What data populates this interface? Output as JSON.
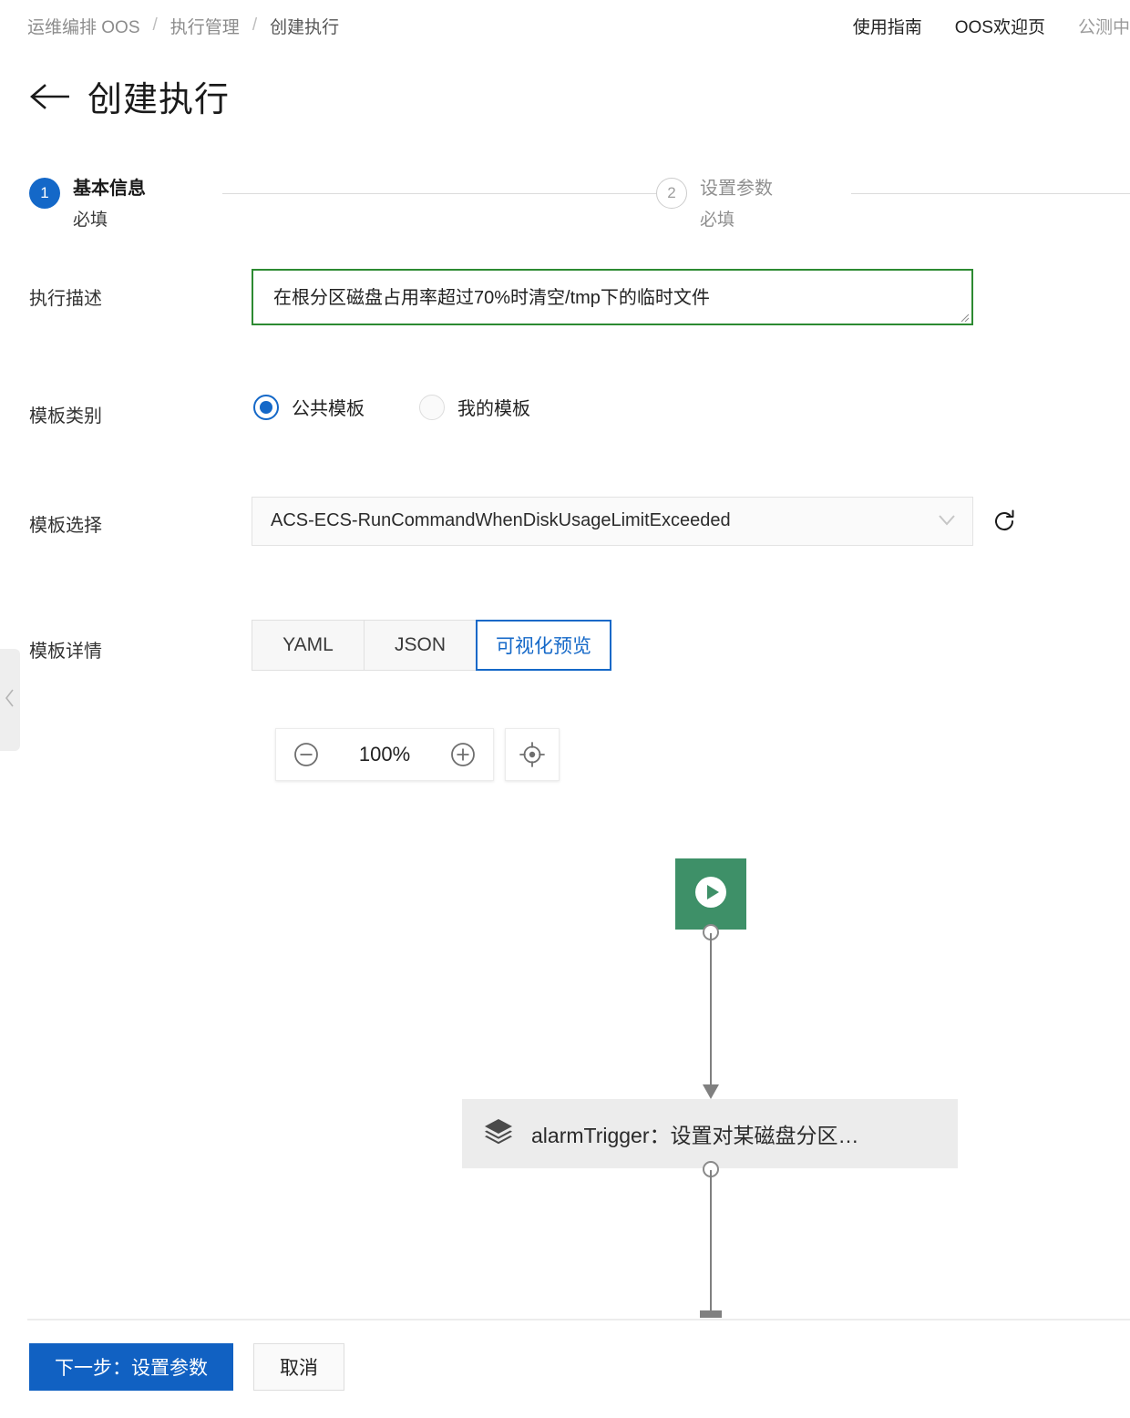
{
  "topbar": {
    "breadcrumb": [
      {
        "label": "运维编排 OOS",
        "current": false
      },
      {
        "label": "执行管理",
        "current": false
      },
      {
        "label": "创建执行",
        "current": true
      }
    ],
    "separator": "/",
    "links": [
      {
        "label": "使用指南"
      },
      {
        "label": "OOS欢迎页"
      },
      {
        "label": "公测中"
      }
    ]
  },
  "page": {
    "back_icon": "arrow-left-icon",
    "title": "创建执行"
  },
  "steps": [
    {
      "number": "1",
      "label": "基本信息",
      "sub": "必填",
      "state": "active"
    },
    {
      "number": "2",
      "label": "设置参数",
      "sub": "必填",
      "state": "inactive"
    }
  ],
  "form": {
    "description": {
      "label": "执行描述",
      "value": "在根分区磁盘占用率超过70%时清空/tmp下的临时文件",
      "placeholder": "请输入执行描述",
      "border_color": "#2d8a32"
    },
    "template_category": {
      "label": "模板类别",
      "options": [
        {
          "label": "公共模板",
          "selected": true
        },
        {
          "label": "我的模板",
          "selected": false
        }
      ]
    },
    "template_select": {
      "label": "模板选择",
      "value": "ACS-ECS-RunCommandWhenDiskUsageLimitExceeded",
      "placeholder": "请选择模板",
      "caret_icon": "chevron-down-icon",
      "refresh_icon": "refresh-icon"
    },
    "template_detail": {
      "label": "模板详情",
      "tabs": [
        {
          "label": "YAML",
          "active": false
        },
        {
          "label": "JSON",
          "active": false
        },
        {
          "label": "可视化预览",
          "active": true
        }
      ]
    }
  },
  "canvas": {
    "zoom": {
      "minus_icon": "minus-circle-icon",
      "value": "100%",
      "plus_icon": "plus-circle-icon",
      "fit_icon": "crosshair-target-icon"
    },
    "nodes": [
      {
        "type": "start",
        "icon": "play-circle-icon",
        "color": "#3e9068",
        "label": ""
      },
      {
        "type": "task",
        "icon": "layers-icon",
        "label": "alarmTrigger：设置对某磁盘分区…"
      }
    ]
  },
  "collapse_handle": {
    "icon": "chevron-left-icon"
  },
  "footer": {
    "primary_label": "下一步：设置参数",
    "cancel_label": "取消"
  },
  "colors": {
    "accent": "#1468c8",
    "primary_button": "#1161c2",
    "start_node": "#3e9068",
    "textarea_border": "#2d8a32",
    "edge": "#808080"
  }
}
